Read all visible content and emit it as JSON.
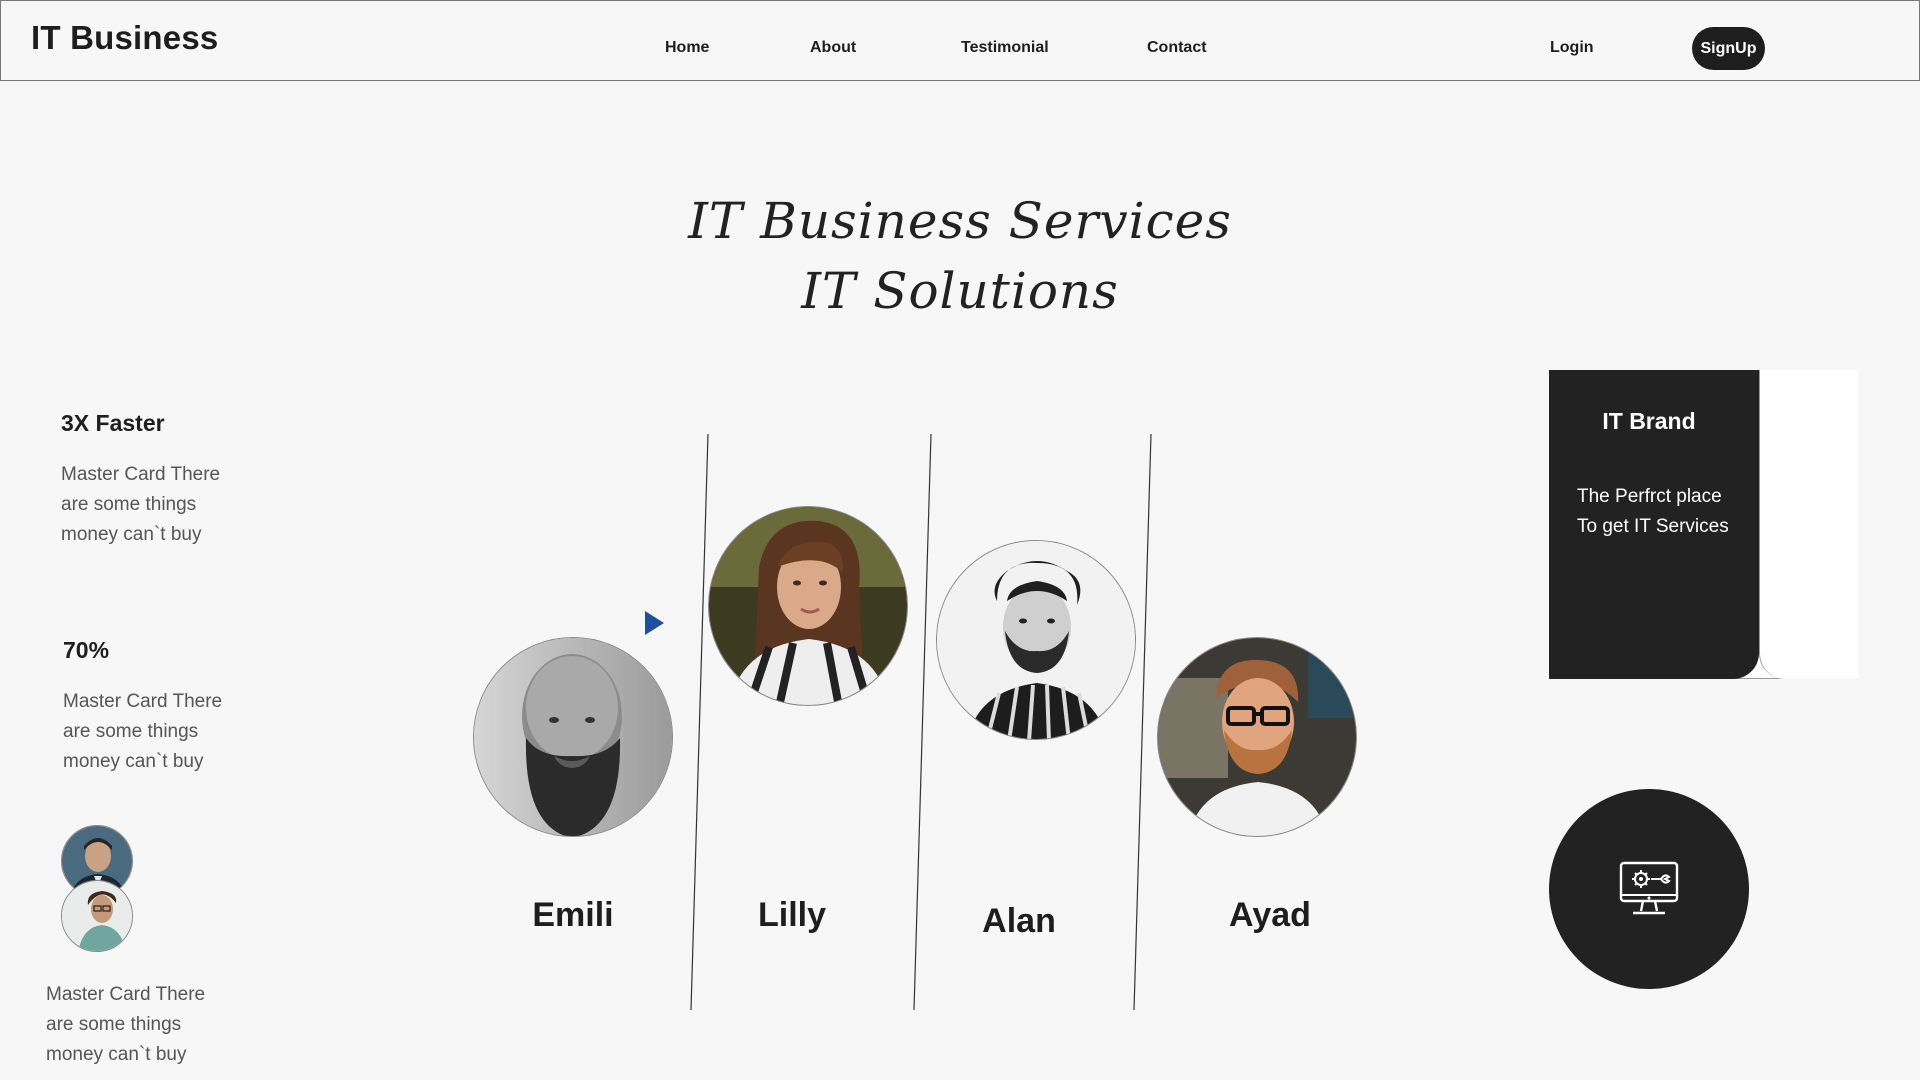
{
  "header": {
    "brand": "IT Business",
    "nav": [
      {
        "label": "Home"
      },
      {
        "label": "About"
      },
      {
        "label": "Testimonial"
      },
      {
        "label": "Contact"
      }
    ],
    "login_label": "Login",
    "signup_label": "SignUp"
  },
  "hero": {
    "line1": "IT Business Services",
    "line2": "IT Solutions"
  },
  "stats": [
    {
      "title": "3X Faster",
      "lines": [
        "Master Card There",
        "are some things",
        "money can`t buy"
      ]
    },
    {
      "title": "70%",
      "lines": [
        "Master Card There",
        "are some things",
        "money can`t buy"
      ]
    }
  ],
  "testimonial_text": {
    "lines": [
      "Master Card There",
      "are some things",
      "money can`t buy"
    ]
  },
  "team": [
    {
      "name": "Emili"
    },
    {
      "name": "Lilly"
    },
    {
      "name": "Alan"
    },
    {
      "name": "Ayad"
    }
  ],
  "brand_card": {
    "title": "IT Brand",
    "line1": "The Perfrct place",
    "line2": "To get IT Services"
  },
  "icons": {
    "play": "play-icon",
    "service": "computer-settings-icon"
  },
  "colors": {
    "dark": "#222222",
    "accent": "#1f4fa0",
    "background": "#f7f7f7"
  }
}
